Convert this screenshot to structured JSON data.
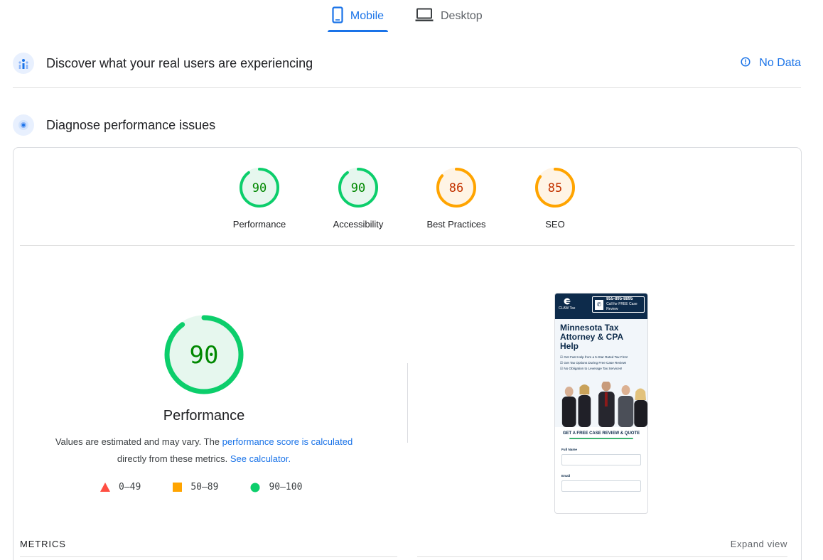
{
  "tabs": [
    {
      "label": "Mobile",
      "icon": "smartphone-icon",
      "active": true
    },
    {
      "label": "Desktop",
      "icon": "laptop-icon",
      "active": false
    }
  ],
  "field_data": {
    "title": "Discover what your real users are experiencing",
    "status": "No Data",
    "status_icon": "info-icon"
  },
  "lab_data": {
    "title": "Diagnose performance issues"
  },
  "categories": [
    {
      "label": "Performance",
      "score": "90",
      "color": "#0cce6b"
    },
    {
      "label": "Accessibility",
      "score": "90",
      "color": "#0cce6b"
    },
    {
      "label": "Best Practices",
      "score": "86",
      "color": "#ffa400"
    },
    {
      "label": "SEO",
      "score": "85",
      "color": "#ffa400"
    }
  ],
  "main_score": {
    "score": "90",
    "label": "Performance",
    "color": "#0cce6b"
  },
  "description": {
    "prefix": "Values are estimated and may vary. The ",
    "link1": "performance score is calculated",
    "middle": "directly from these metrics. ",
    "link2": "See calculator."
  },
  "legend": [
    {
      "range": "0–49",
      "color": "#ff4e42",
      "shape": "triangle"
    },
    {
      "range": "50–89",
      "color": "#ffa400",
      "shape": "square"
    },
    {
      "range": "90–100",
      "color": "#0cce6b",
      "shape": "circle"
    }
  ],
  "screenshot": {
    "phone": "855-895-8895",
    "phone_sub": "Call for FREE Case Review",
    "logo": "CLAW Tax",
    "headline_1": "Minnesota Tax",
    "headline_2": "Attorney & CPA Help",
    "bullets": [
      "☑ Get Fast Help from a 5-Star Rated Tax Firm!",
      "☑ Get Tax Options During Free Case Review!",
      "☑ No Obligation to Leverage Tax Services!"
    ],
    "cta": "GET A FREE CASE REVIEW & QUOTE",
    "field1": "Full Name",
    "field2": "Email"
  },
  "metrics_label": "METRICS",
  "expand_label": "Expand view"
}
